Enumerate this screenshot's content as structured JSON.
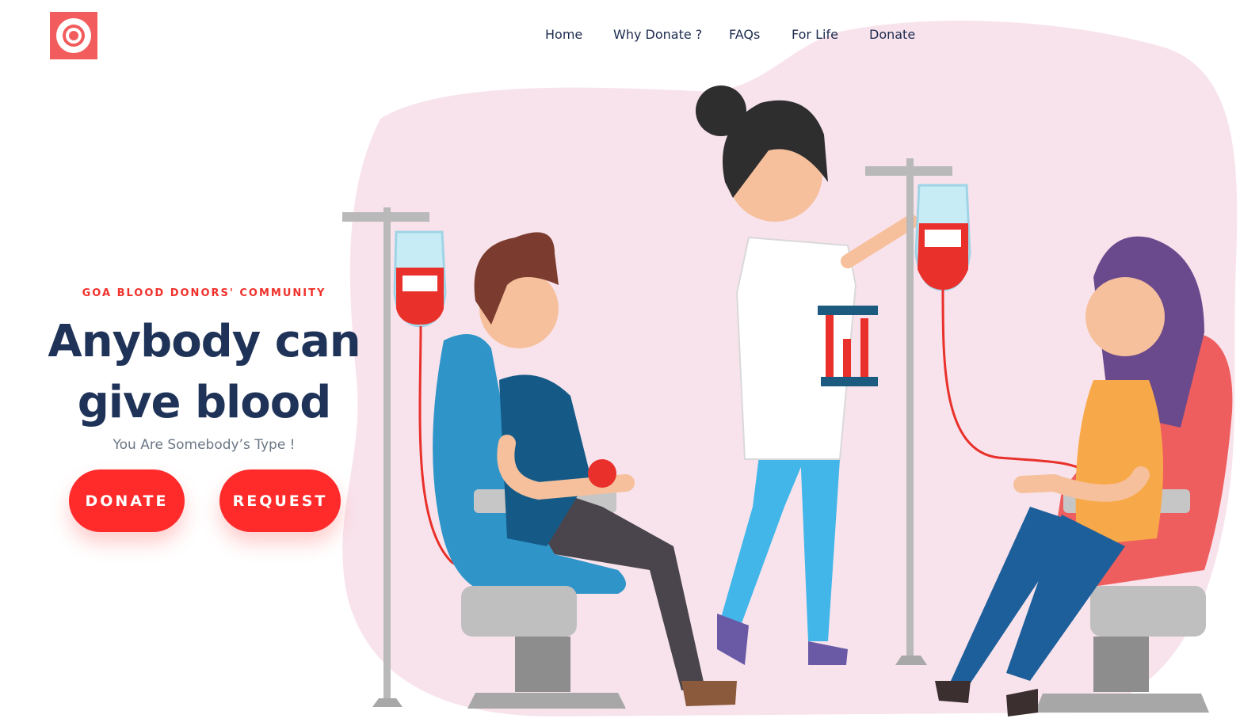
{
  "header": {
    "logo_icon": "target-icon",
    "nav": [
      {
        "label": "Home"
      },
      {
        "label": "Why Donate ?"
      },
      {
        "label": "FAQs"
      },
      {
        "label": "For Life"
      },
      {
        "label": "Donate"
      }
    ]
  },
  "hero": {
    "eyebrow": "GOA BLOOD DONORS' COMMUNITY",
    "headline_line1": "Anybody can",
    "headline_line2": "give blood",
    "tagline": "You Are Somebody’s Type !",
    "donate_label": "DONATE",
    "request_label": "REQUEST"
  },
  "colors": {
    "accent": "#ff2b2b",
    "logo": "#f25c5c",
    "heading": "#1f3358",
    "blob": "#f8e3ec"
  }
}
